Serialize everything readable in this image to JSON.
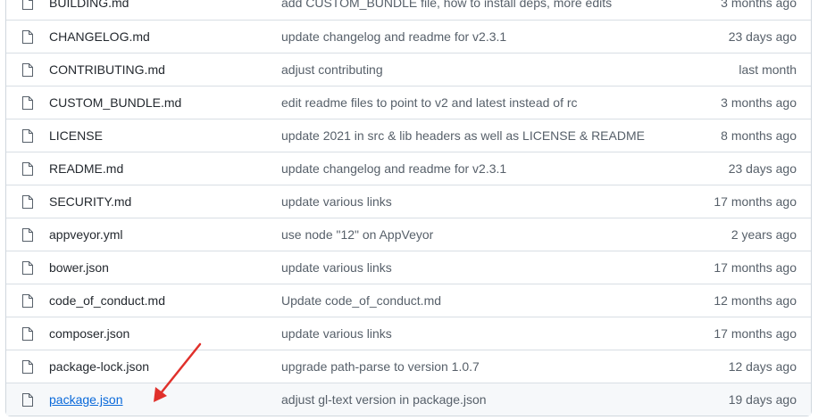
{
  "icons": {
    "file": "file-icon",
    "arrow": "red-annotation-arrow"
  },
  "colors": {
    "link": "#0969da",
    "annotation": "#e0302b",
    "border": "#d0d7de"
  },
  "files": [
    {
      "name": "BUILDING.md",
      "message": "add CUSTOM_BUNDLE file, how to install deps, more edits",
      "age": "3 months ago"
    },
    {
      "name": "CHANGELOG.md",
      "message": "update changelog and readme for v2.3.1",
      "age": "23 days ago"
    },
    {
      "name": "CONTRIBUTING.md",
      "message": "adjust contributing",
      "age": "last month"
    },
    {
      "name": "CUSTOM_BUNDLE.md",
      "message": "edit readme files to point to v2 and latest instead of rc",
      "age": "3 months ago"
    },
    {
      "name": "LICENSE",
      "message": "update 2021 in src & lib headers as well as LICENSE & README",
      "age": "8 months ago"
    },
    {
      "name": "README.md",
      "message": "update changelog and readme for v2.3.1",
      "age": "23 days ago"
    },
    {
      "name": "SECURITY.md",
      "message": "update various links",
      "age": "17 months ago"
    },
    {
      "name": "appveyor.yml",
      "message": "use node \"12\" on AppVeyor",
      "age": "2 years ago"
    },
    {
      "name": "bower.json",
      "message": "update various links",
      "age": "17 months ago"
    },
    {
      "name": "code_of_conduct.md",
      "message": "Update code_of_conduct.md",
      "age": "12 months ago"
    },
    {
      "name": "composer.json",
      "message": "update various links",
      "age": "17 months ago"
    },
    {
      "name": "package-lock.json",
      "message": "upgrade path-parse to version 1.0.7",
      "age": "12 days ago"
    },
    {
      "name": "package.json",
      "message": "adjust gl-text version in package.json",
      "age": "19 days ago"
    }
  ]
}
